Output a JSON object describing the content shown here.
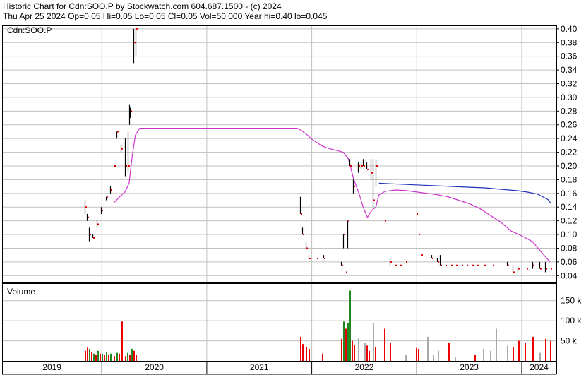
{
  "header": {
    "line1": "Historic Chart for Cdn:SOO.P by Stockwatch.com 604.687.1500 - (c) 2024",
    "line2": "Thu Apr 25 2024   Op=0.05  Hi=0.05  Lo=0.05  Cl=0.05  Vol=50,000  Year hi=0.40  lo=0.045"
  },
  "colors": {
    "background": "#ffffff",
    "grid": "#c0c0c0",
    "axis": "#000000",
    "price_bar": "#000000",
    "price_dot": "#dd0000",
    "ma_short": "#cc33cc",
    "ma_long": "#2233bb",
    "vol_up": "#ee0000",
    "vol_down": "#228822",
    "vol_flat": "#aaaaaa"
  },
  "chart_data": [
    {
      "type": "line",
      "title": "Cdn:SOO.P",
      "xlabel": "",
      "ylabel": "",
      "yticks": [
        "0.40",
        "0.38",
        "0.36",
        "0.34",
        "0.32",
        "0.30",
        "0.28",
        "0.26",
        "0.24",
        "0.22",
        "0.20",
        "0.18",
        "0.16",
        "0.14",
        "0.12",
        "0.10",
        "0.08",
        "0.06",
        "0.04"
      ],
      "ylim": [
        0.03,
        0.405
      ],
      "xlim": [
        2019.05,
        2024.33
      ],
      "grid": true,
      "price_bars": [
        {
          "t": 2019.84,
          "hi": 0.15,
          "lo": 0.13,
          "cl": 0.14
        },
        {
          "t": 2019.86,
          "hi": 0.13,
          "lo": 0.12,
          "cl": 0.125
        },
        {
          "t": 2019.88,
          "hi": 0.11,
          "lo": 0.09,
          "cl": 0.1
        },
        {
          "t": 2019.91,
          "hi": 0.1,
          "lo": 0.095,
          "cl": 0.095
        },
        {
          "t": 2019.95,
          "hi": 0.12,
          "lo": 0.11,
          "cl": 0.115
        },
        {
          "t": 2019.99,
          "hi": 0.14,
          "lo": 0.13,
          "cl": 0.135
        },
        {
          "t": 2020.04,
          "hi": 0.155,
          "lo": 0.15,
          "cl": 0.155
        },
        {
          "t": 2020.08,
          "hi": 0.17,
          "lo": 0.16,
          "cl": 0.165
        },
        {
          "t": 2020.11,
          "hi": 0.2,
          "lo": 0.2,
          "cl": 0.2
        },
        {
          "t": 2020.14,
          "hi": 0.25,
          "lo": 0.24,
          "cl": 0.25
        },
        {
          "t": 2020.18,
          "hi": 0.23,
          "lo": 0.22,
          "cl": 0.225
        },
        {
          "t": 2020.22,
          "hi": 0.24,
          "lo": 0.185,
          "cl": 0.2
        },
        {
          "t": 2020.245,
          "hi": 0.25,
          "lo": 0.19,
          "cl": 0.2
        },
        {
          "t": 2020.26,
          "hi": 0.29,
          "lo": 0.26,
          "cl": 0.28
        },
        {
          "t": 2020.27,
          "hi": 0.285,
          "lo": 0.27,
          "cl": 0.28
        },
        {
          "t": 2020.3,
          "hi": 0.4,
          "lo": 0.35,
          "cl": 0.38
        },
        {
          "t": 2020.32,
          "hi": 0.4,
          "lo": 0.36,
          "cl": 0.4
        },
        {
          "t": 2021.89,
          "hi": 0.155,
          "lo": 0.13,
          "cl": 0.13
        },
        {
          "t": 2021.91,
          "hi": 0.11,
          "lo": 0.1,
          "cl": 0.1
        },
        {
          "t": 2021.94,
          "hi": 0.09,
          "lo": 0.08,
          "cl": 0.08
        },
        {
          "t": 2021.97,
          "hi": 0.07,
          "lo": 0.065,
          "cl": 0.065
        },
        {
          "t": 2022.04,
          "hi": 0.065,
          "lo": 0.065,
          "cl": 0.065
        },
        {
          "t": 2022.11,
          "hi": 0.07,
          "lo": 0.065,
          "cl": 0.065
        },
        {
          "t": 2022.28,
          "hi": 0.06,
          "lo": 0.055,
          "cl": 0.055
        },
        {
          "t": 2022.3,
          "hi": 0.1,
          "lo": 0.08,
          "cl": 0.1
        },
        {
          "t": 2022.32,
          "hi": 0.045,
          "lo": 0.045,
          "cl": 0.045
        },
        {
          "t": 2022.34,
          "hi": 0.12,
          "lo": 0.08,
          "cl": 0.12
        },
        {
          "t": 2022.36,
          "hi": 0.21,
          "lo": 0.2,
          "cl": 0.2
        },
        {
          "t": 2022.39,
          "hi": 0.18,
          "lo": 0.16,
          "cl": 0.17
        },
        {
          "t": 2022.44,
          "hi": 0.205,
          "lo": 0.19,
          "cl": 0.2
        },
        {
          "t": 2022.47,
          "hi": 0.205,
          "lo": 0.195,
          "cl": 0.2
        },
        {
          "t": 2022.49,
          "hi": 0.21,
          "lo": 0.2,
          "cl": 0.2
        },
        {
          "t": 2022.52,
          "hi": 0.205,
          "lo": 0.195,
          "cl": 0.195
        },
        {
          "t": 2022.56,
          "hi": 0.21,
          "lo": 0.18,
          "cl": 0.19
        },
        {
          "t": 2022.58,
          "hi": 0.21,
          "lo": 0.14,
          "cl": 0.15
        },
        {
          "t": 2022.61,
          "hi": 0.21,
          "lo": 0.17,
          "cl": 0.2
        },
        {
          "t": 2022.69,
          "hi": 0.12,
          "lo": 0.12,
          "cl": 0.12
        },
        {
          "t": 2022.74,
          "hi": 0.065,
          "lo": 0.055,
          "cl": 0.06
        },
        {
          "t": 2022.79,
          "hi": 0.055,
          "lo": 0.055,
          "cl": 0.055
        },
        {
          "t": 2022.84,
          "hi": 0.055,
          "lo": 0.055,
          "cl": 0.055
        },
        {
          "t": 2022.89,
          "hi": 0.06,
          "lo": 0.06,
          "cl": 0.06
        },
        {
          "t": 2022.99,
          "hi": 0.13,
          "lo": 0.13,
          "cl": 0.13
        },
        {
          "t": 2023.01,
          "hi": 0.1,
          "lo": 0.1,
          "cl": 0.1
        },
        {
          "t": 2023.04,
          "hi": 0.07,
          "lo": 0.07,
          "cl": 0.07
        },
        {
          "t": 2023.14,
          "hi": 0.07,
          "lo": 0.065,
          "cl": 0.065
        },
        {
          "t": 2023.19,
          "hi": 0.065,
          "lo": 0.06,
          "cl": 0.06
        },
        {
          "t": 2023.22,
          "hi": 0.07,
          "lo": 0.055,
          "cl": 0.055
        },
        {
          "t": 2023.27,
          "hi": 0.055,
          "lo": 0.055,
          "cl": 0.055
        },
        {
          "t": 2023.32,
          "hi": 0.055,
          "lo": 0.055,
          "cl": 0.055
        },
        {
          "t": 2023.37,
          "hi": 0.055,
          "lo": 0.055,
          "cl": 0.055
        },
        {
          "t": 2023.42,
          "hi": 0.055,
          "lo": 0.055,
          "cl": 0.055
        },
        {
          "t": 2023.47,
          "hi": 0.055,
          "lo": 0.055,
          "cl": 0.055
        },
        {
          "t": 2023.52,
          "hi": 0.055,
          "lo": 0.055,
          "cl": 0.055
        },
        {
          "t": 2023.57,
          "hi": 0.055,
          "lo": 0.055,
          "cl": 0.055
        },
        {
          "t": 2023.64,
          "hi": 0.055,
          "lo": 0.055,
          "cl": 0.055
        },
        {
          "t": 2023.72,
          "hi": 0.055,
          "lo": 0.055,
          "cl": 0.055
        },
        {
          "t": 2023.86,
          "hi": 0.06,
          "lo": 0.055,
          "cl": 0.055
        },
        {
          "t": 2023.91,
          "hi": 0.055,
          "lo": 0.045,
          "cl": 0.045
        },
        {
          "t": 2023.96,
          "hi": 0.05,
          "lo": 0.045,
          "cl": 0.05
        },
        {
          "t": 2024.04,
          "hi": 0.05,
          "lo": 0.05,
          "cl": 0.05
        },
        {
          "t": 2024.1,
          "hi": 0.06,
          "lo": 0.05,
          "cl": 0.055
        },
        {
          "t": 2024.17,
          "hi": 0.06,
          "lo": 0.05,
          "cl": 0.05
        },
        {
          "t": 2024.22,
          "hi": 0.06,
          "lo": 0.045,
          "cl": 0.05
        },
        {
          "t": 2024.27,
          "hi": 0.05,
          "lo": 0.05,
          "cl": 0.05
        }
      ],
      "series": [
        {
          "style": "ma_short",
          "x": [
            2020.12,
            2020.17,
            2020.22,
            2020.26,
            2020.29,
            2020.32,
            2020.36,
            2020.5,
            2021.0,
            2021.5,
            2021.86,
            2021.9,
            2021.95,
            2022.0,
            2022.05,
            2022.1,
            2022.15,
            2022.2,
            2022.25,
            2022.3,
            2022.35,
            2022.4,
            2022.45,
            2022.49,
            2022.53,
            2022.57,
            2022.61,
            2022.64,
            2022.7,
            2022.8,
            2022.9,
            2023.0,
            2023.1,
            2023.2,
            2023.3,
            2023.4,
            2023.5,
            2023.6,
            2023.7,
            2023.8,
            2023.9,
            2024.0,
            2024.1,
            2024.2,
            2024.27
          ],
          "y": [
            0.147,
            0.155,
            0.162,
            0.175,
            0.215,
            0.245,
            0.255,
            0.255,
            0.255,
            0.255,
            0.255,
            0.252,
            0.246,
            0.239,
            0.234,
            0.229,
            0.226,
            0.224,
            0.222,
            0.22,
            0.21,
            0.18,
            0.16,
            0.14,
            0.125,
            0.135,
            0.14,
            0.158,
            0.163,
            0.165,
            0.164,
            0.162,
            0.16,
            0.158,
            0.155,
            0.15,
            0.145,
            0.138,
            0.128,
            0.118,
            0.105,
            0.098,
            0.09,
            0.072,
            0.06
          ]
        },
        {
          "style": "ma_long",
          "x": [
            2022.64,
            2022.75,
            2022.9,
            2023.05,
            2023.2,
            2023.35,
            2023.5,
            2023.65,
            2023.8,
            2023.95,
            2024.05,
            2024.15,
            2024.25,
            2024.28
          ],
          "y": [
            0.175,
            0.174,
            0.173,
            0.172,
            0.171,
            0.17,
            0.169,
            0.168,
            0.166,
            0.164,
            0.162,
            0.159,
            0.151,
            0.145
          ]
        }
      ]
    },
    {
      "type": "bar",
      "title": "Volume",
      "yticks": [
        {
          "label": "50 k",
          "value": 50000
        },
        {
          "label": "100 k",
          "value": 100000
        },
        {
          "label": "150 k",
          "value": 150000
        }
      ],
      "ylim": [
        0,
        190000
      ],
      "x": [
        2019.84,
        2019.86,
        2019.88,
        2019.9,
        2019.92,
        2019.94,
        2019.96,
        2019.98,
        2020.0,
        2020.02,
        2020.04,
        2020.06,
        2020.08,
        2020.11,
        2020.14,
        2020.16,
        2020.19,
        2020.22,
        2020.24,
        2020.26,
        2020.28,
        2020.3,
        2020.32,
        2021.89,
        2021.91,
        2021.94,
        2021.97,
        2022.1,
        2022.28,
        2022.3,
        2022.32,
        2022.34,
        2022.36,
        2022.38,
        2022.4,
        2022.44,
        2022.5,
        2022.52,
        2022.54,
        2022.58,
        2022.6,
        2022.69,
        2022.74,
        2022.89,
        2022.99,
        2023.01,
        2023.1,
        2023.15,
        2023.2,
        2023.3,
        2023.36,
        2023.55,
        2023.63,
        2023.7,
        2023.75,
        2023.86,
        2023.91,
        2023.97,
        2024.03,
        2024.1,
        2024.17,
        2024.22,
        2024.27
      ],
      "values": [
        25000,
        33000,
        30000,
        22000,
        18000,
        15000,
        25000,
        18000,
        18000,
        15000,
        22000,
        15000,
        18000,
        12000,
        20000,
        18000,
        98000,
        12000,
        20000,
        15000,
        30000,
        25000,
        15000,
        60000,
        42000,
        35000,
        30000,
        18000,
        55000,
        98000,
        80000,
        95000,
        175000,
        50000,
        40000,
        58000,
        45000,
        38000,
        25000,
        95000,
        35000,
        80000,
        45000,
        15000,
        32000,
        30000,
        60000,
        15000,
        25000,
        45000,
        10000,
        15000,
        30000,
        25000,
        80000,
        38000,
        35000,
        50000,
        45000,
        60000,
        20000,
        55000,
        50000
      ],
      "dirs": [
        "up",
        "up",
        "down",
        "up",
        "down",
        "up",
        "down",
        "up",
        "down",
        "up",
        "down",
        "up",
        "down",
        "up",
        "down",
        "up",
        "up",
        "up",
        "down",
        "up",
        "down",
        "up",
        "up",
        "up",
        "up",
        "up",
        "up",
        "up",
        "up",
        "down",
        "up",
        "down",
        "down",
        "up",
        "up",
        "flat",
        "flat",
        "up",
        "up",
        "flat",
        "up",
        "up",
        "up",
        "flat",
        "up",
        "up",
        "flat",
        "flat",
        "flat",
        "up",
        "flat",
        "up",
        "flat",
        "flat",
        "flat",
        "flat",
        "up",
        "up",
        "up",
        "up",
        "flat",
        "up",
        "up"
      ]
    }
  ],
  "x_axis": {
    "year_labels": [
      "2019",
      "2020",
      "2021",
      "2022",
      "2023",
      "2024"
    ]
  }
}
